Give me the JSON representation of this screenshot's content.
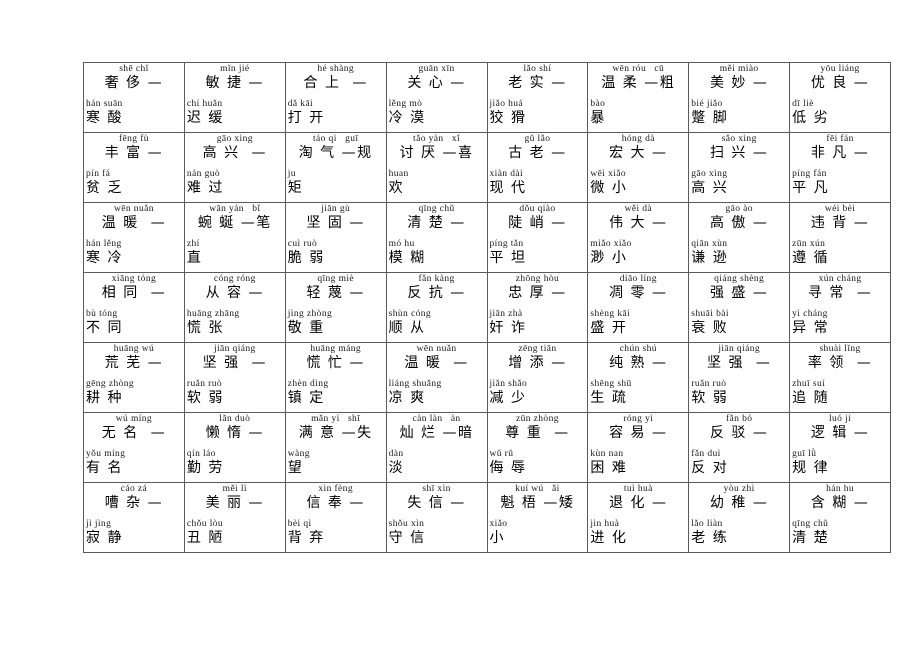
{
  "page": {
    "background_color": "#ffffff",
    "border_color": "#5a5a66",
    "text_color": "#000000"
  },
  "table": {
    "columns": 8,
    "rows": 7,
    "rows_data": [
      [
        {
          "top_pinyin": "shē chǐ",
          "top_hanzi": "奢 侈 —",
          "bot_pinyin": "hán suān",
          "bot_hanzi": "寒 酸"
        },
        {
          "top_pinyin": "mǐn jié",
          "top_hanzi": "敏 捷 —",
          "bot_pinyin": "chí huǎn",
          "bot_hanzi": "迟 缓"
        },
        {
          "top_pinyin": "hé shàng",
          "top_hanzi": "合 上  —",
          "bot_pinyin": "dǎ kāi",
          "bot_hanzi": "打 开"
        },
        {
          "top_pinyin": "guān xīn",
          "top_hanzi": "关 心 —",
          "bot_pinyin": "lěng mò",
          "bot_hanzi": "冷 漠"
        },
        {
          "top_pinyin": "lǎo shí",
          "top_hanzi": "老 实 —",
          "bot_pinyin": "jiǎo huá",
          "bot_hanzi": "狡 猾"
        },
        {
          "top_pinyin": "wēn róu   cū",
          "top_hanzi": "温 柔 —粗",
          "bot_pinyin": "bào",
          "bot_hanzi": "暴"
        },
        {
          "top_pinyin": "měi miào",
          "top_hanzi": "美 妙 —",
          "bot_pinyin": "bié jiǎo",
          "bot_hanzi": "蹩 脚"
        },
        {
          "top_pinyin": "yōu liáng",
          "top_hanzi": "优 良 —",
          "bot_pinyin": "dī liè",
          "bot_hanzi": "低 劣"
        }
      ],
      [
        {
          "top_pinyin": "fēng fù",
          "top_hanzi": "丰 富 —",
          "bot_pinyin": "pín fá",
          "bot_hanzi": "贫 乏"
        },
        {
          "top_pinyin": "gāo xìng",
          "top_hanzi": "高 兴  —",
          "bot_pinyin": "nán guò",
          "bot_hanzi": "难 过"
        },
        {
          "top_pinyin": "táo qì   guī",
          "top_hanzi": "淘 气 —规",
          "bot_pinyin": "ju",
          "bot_hanzi": "矩"
        },
        {
          "top_pinyin": "tǎo yàn   xǐ",
          "top_hanzi": "讨 厌 —喜",
          "bot_pinyin": "huan",
          "bot_hanzi": "欢"
        },
        {
          "top_pinyin": "gǔ lǎo",
          "top_hanzi": "古 老 —",
          "bot_pinyin": "xiàn dài",
          "bot_hanzi": "现 代"
        },
        {
          "top_pinyin": "hóng dà",
          "top_hanzi": "宏 大 —",
          "bot_pinyin": "wēi xiǎo",
          "bot_hanzi": "微 小"
        },
        {
          "top_pinyin": "sǎo xìng",
          "top_hanzi": "扫 兴 —",
          "bot_pinyin": "gāo xìng",
          "bot_hanzi": "高 兴"
        },
        {
          "top_pinyin": "fēi fán",
          "top_hanzi": "非 凡 —",
          "bot_pinyin": "píng fán",
          "bot_hanzi": "平 凡"
        }
      ],
      [
        {
          "top_pinyin": "wēn nuǎn",
          "top_hanzi": "温 暖  —",
          "bot_pinyin": "hán lěng",
          "bot_hanzi": "寒 冷"
        },
        {
          "top_pinyin": "wān yán   bǐ",
          "top_hanzi": "蜿 蜒 —笔",
          "bot_pinyin": "zhí",
          "bot_hanzi": "直"
        },
        {
          "top_pinyin": "jiān gù",
          "top_hanzi": "坚 固 —",
          "bot_pinyin": "cuì ruò",
          "bot_hanzi": "脆 弱"
        },
        {
          "top_pinyin": "qīng chǔ",
          "top_hanzi": "清 楚 —",
          "bot_pinyin": "mó hu",
          "bot_hanzi": "模 糊"
        },
        {
          "top_pinyin": "dǒu qiào",
          "top_hanzi": "陡 峭 —",
          "bot_pinyin": "píng tǎn",
          "bot_hanzi": "平 坦"
        },
        {
          "top_pinyin": "wěi dà",
          "top_hanzi": "伟 大 —",
          "bot_pinyin": "miǎo xiǎo",
          "bot_hanzi": "渺 小"
        },
        {
          "top_pinyin": "gāo ào",
          "top_hanzi": "高 傲 —",
          "bot_pinyin": "qiān xùn",
          "bot_hanzi": "谦 逊"
        },
        {
          "top_pinyin": "wéi bèi",
          "top_hanzi": "违 背 —",
          "bot_pinyin": "zūn xún",
          "bot_hanzi": "遵 循"
        }
      ],
      [
        {
          "top_pinyin": "xiāng tóng",
          "top_hanzi": "相 同  —",
          "bot_pinyin": "bù tóng",
          "bot_hanzi": "不 同"
        },
        {
          "top_pinyin": "cóng róng",
          "top_hanzi": "从 容 —",
          "bot_pinyin": "huāng zhāng",
          "bot_hanzi": "慌 张"
        },
        {
          "top_pinyin": "qīng miè",
          "top_hanzi": "轻 蔑 —",
          "bot_pinyin": "jìng zhòng",
          "bot_hanzi": "敬 重"
        },
        {
          "top_pinyin": "fǎn kàng",
          "top_hanzi": "反 抗 —",
          "bot_pinyin": "shùn cóng",
          "bot_hanzi": "顺 从"
        },
        {
          "top_pinyin": "zhōng hòu",
          "top_hanzi": "忠 厚 —",
          "bot_pinyin": "jiān zhà",
          "bot_hanzi": "奸 诈"
        },
        {
          "top_pinyin": "diāo líng",
          "top_hanzi": "凋 零 —",
          "bot_pinyin": "shèng kāi",
          "bot_hanzi": "盛 开"
        },
        {
          "top_pinyin": "qiáng shèng",
          "top_hanzi": "强 盛 —",
          "bot_pinyin": "shuāi bài",
          "bot_hanzi": "衰 败"
        },
        {
          "top_pinyin": "xún cháng",
          "top_hanzi": "寻 常  —",
          "bot_pinyin": "yì cháng",
          "bot_hanzi": "异 常"
        }
      ],
      [
        {
          "top_pinyin": "huāng wú",
          "top_hanzi": "荒 芜 —",
          "bot_pinyin": "gēng zhòng",
          "bot_hanzi": "耕 种"
        },
        {
          "top_pinyin": "jiān qiáng",
          "top_hanzi": "坚 强  —",
          "bot_pinyin": "ruǎn ruò",
          "bot_hanzi": "软 弱"
        },
        {
          "top_pinyin": "huāng máng",
          "top_hanzi": "慌 忙 —",
          "bot_pinyin": "zhèn dìng",
          "bot_hanzi": "镇 定"
        },
        {
          "top_pinyin": "wēn nuǎn",
          "top_hanzi": "温 暖  —",
          "bot_pinyin": "liáng shuǎng",
          "bot_hanzi": "凉 爽"
        },
        {
          "top_pinyin": "zēng tiān",
          "top_hanzi": "增 添 —",
          "bot_pinyin": "jiǎn shǎo",
          "bot_hanzi": "减 少"
        },
        {
          "top_pinyin": "chún shú",
          "top_hanzi": "纯 熟 —",
          "bot_pinyin": "shēng shū",
          "bot_hanzi": "生 疏"
        },
        {
          "top_pinyin": "jiān qiáng",
          "top_hanzi": "坚 强  —",
          "bot_pinyin": "ruǎn ruò",
          "bot_hanzi": "软 弱"
        },
        {
          "top_pinyin": "shuài lǐng",
          "top_hanzi": "率 领  —",
          "bot_pinyin": "zhuī suí",
          "bot_hanzi": "追 随"
        }
      ],
      [
        {
          "top_pinyin": "wú míng",
          "top_hanzi": "无 名  —",
          "bot_pinyin": "yǒu míng",
          "bot_hanzi": "有 名"
        },
        {
          "top_pinyin": "lǎn duò",
          "top_hanzi": "懒 惰 —",
          "bot_pinyin": "qín láo",
          "bot_hanzi": "勤 劳"
        },
        {
          "top_pinyin": "mǎn yì   shī",
          "top_hanzi": "满 意 —失",
          "bot_pinyin": "wàng",
          "bot_hanzi": "望"
        },
        {
          "top_pinyin": "càn làn   àn",
          "top_hanzi": "灿 烂 —暗",
          "bot_pinyin": "dàn",
          "bot_hanzi": "淡"
        },
        {
          "top_pinyin": "zūn zhòng",
          "top_hanzi": "尊 重  —",
          "bot_pinyin": "wǔ rǔ",
          "bot_hanzi": "侮 辱"
        },
        {
          "top_pinyin": "róng yì",
          "top_hanzi": "容 易 —",
          "bot_pinyin": "kùn nan",
          "bot_hanzi": "困 难"
        },
        {
          "top_pinyin": "fǎn bó",
          "top_hanzi": "反 驳 —",
          "bot_pinyin": "fǎn duì",
          "bot_hanzi": "反 对"
        },
        {
          "top_pinyin": "luó jí",
          "top_hanzi": "逻 辑 —",
          "bot_pinyin": "guī lǜ",
          "bot_hanzi": "规 律"
        }
      ],
      [
        {
          "top_pinyin": "cáo zá",
          "top_hanzi": "嘈 杂 —",
          "bot_pinyin": "jì jìng",
          "bot_hanzi": "寂 静"
        },
        {
          "top_pinyin": "měi lì",
          "top_hanzi": "美 丽 —",
          "bot_pinyin": "chǒu lòu",
          "bot_hanzi": "丑 陋"
        },
        {
          "top_pinyin": "xìn fèng",
          "top_hanzi": "信 奉 —",
          "bot_pinyin": "bèi qì",
          "bot_hanzi": "背 弃"
        },
        {
          "top_pinyin": "shī xìn",
          "top_hanzi": "失 信 —",
          "bot_pinyin": "shǒu xìn",
          "bot_hanzi": "守 信"
        },
        {
          "top_pinyin": "kuí wú   ǎi",
          "top_hanzi": "魁 梧 —矮",
          "bot_pinyin": "xiǎo",
          "bot_hanzi": "小"
        },
        {
          "top_pinyin": "tuì huà",
          "top_hanzi": "退 化 —",
          "bot_pinyin": "jin huà",
          "bot_hanzi": "进 化"
        },
        {
          "top_pinyin": "yòu zhì",
          "top_hanzi": "幼 稚 —",
          "bot_pinyin": "lǎo liàn",
          "bot_hanzi": "老 练"
        },
        {
          "top_pinyin": "hán hu",
          "top_hanzi": "含 糊 —",
          "bot_pinyin": "qīng chǔ",
          "bot_hanzi": "清 楚"
        }
      ]
    ]
  }
}
